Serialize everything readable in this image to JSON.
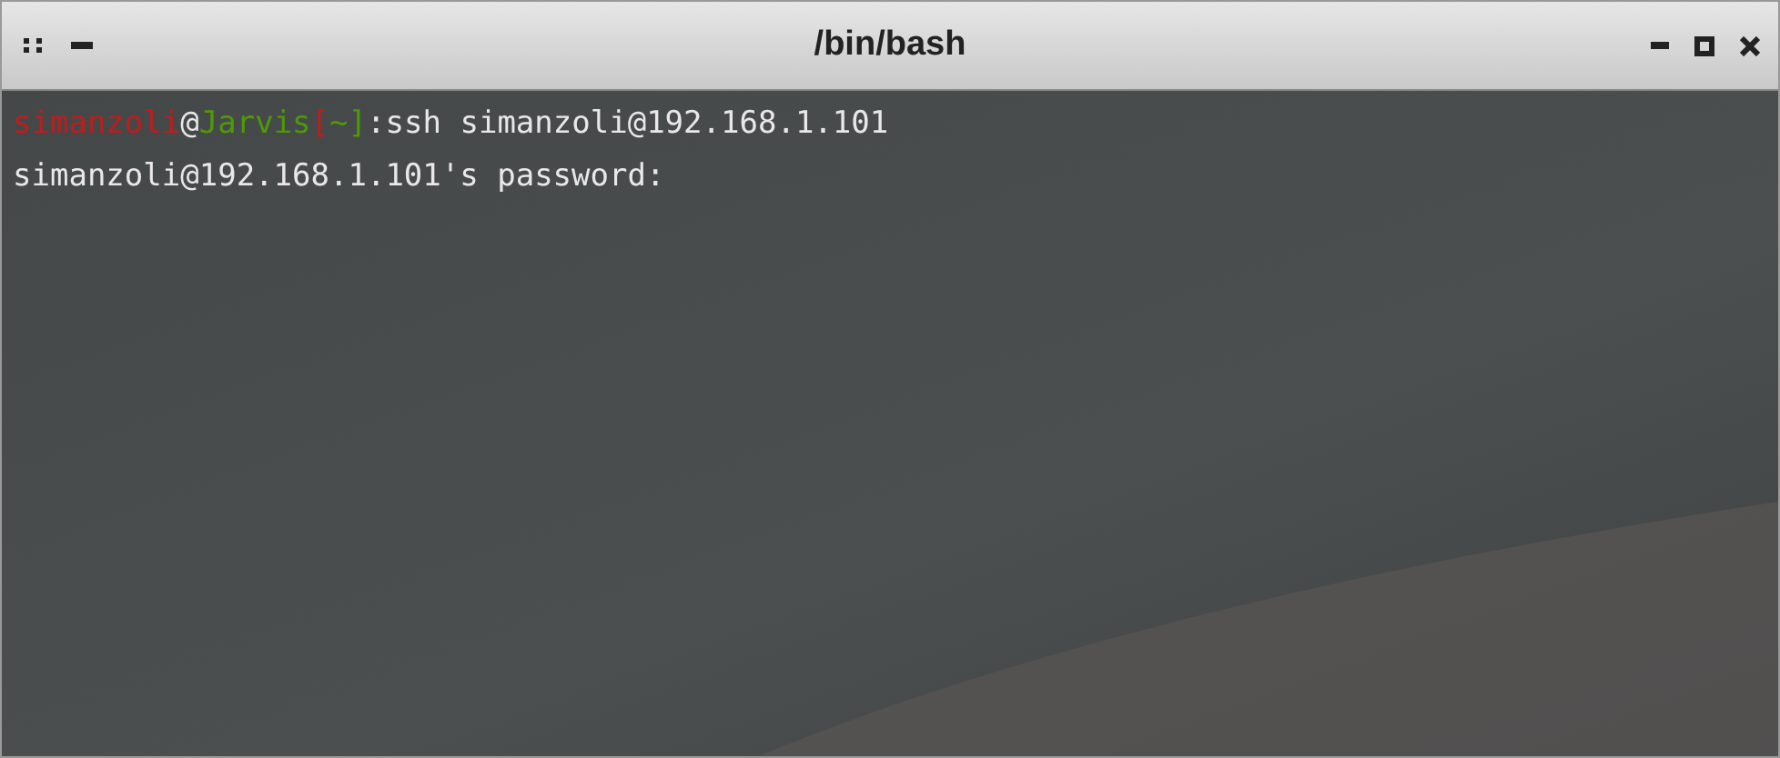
{
  "window": {
    "title": "/bin/bash"
  },
  "terminal": {
    "lines": [
      {
        "segments": [
          {
            "text": "simanzoli",
            "color": "#c01c1c"
          },
          {
            "text": "@",
            "color": "#e8e8e8"
          },
          {
            "text": "Jarvis",
            "color": "#4e9a06"
          },
          {
            "text": "[",
            "color": "#c01c1c"
          },
          {
            "text": "~",
            "color": "#4e9a06"
          },
          {
            "text": "]",
            "color": "#4e9a06"
          },
          {
            "text": ":ssh simanzoli@192.168.1.101",
            "color": "#e8e8e8"
          }
        ]
      },
      {
        "segments": [
          {
            "text": "simanzoli@192.168.1.101's password:",
            "color": "#e8e8e8"
          }
        ]
      }
    ]
  }
}
